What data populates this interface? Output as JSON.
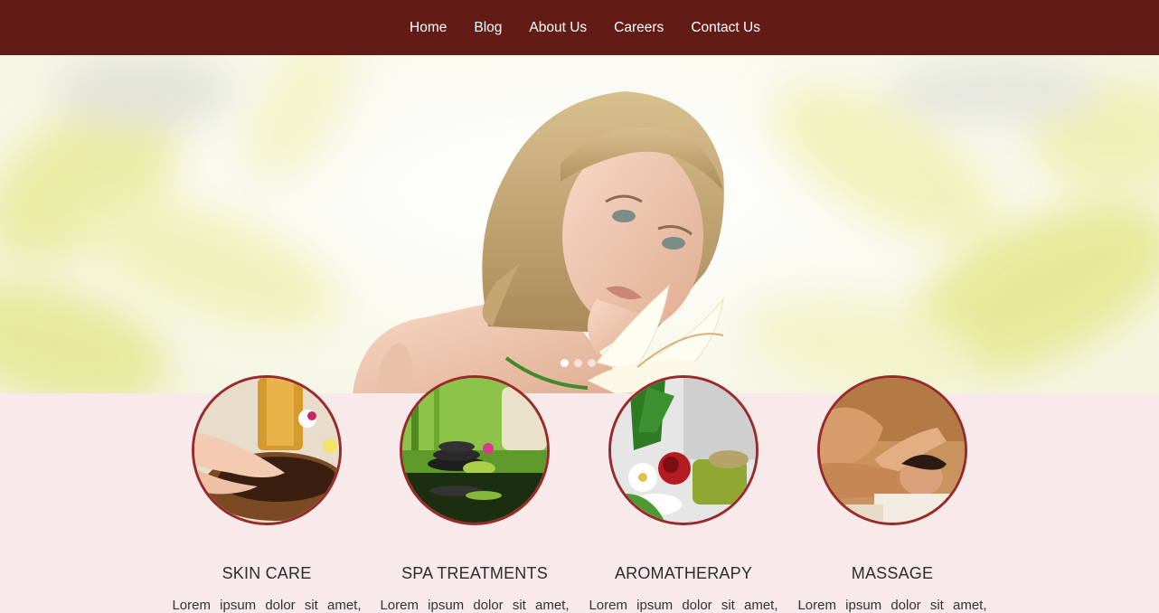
{
  "nav": {
    "items": [
      {
        "label": "Home"
      },
      {
        "label": "Blog"
      },
      {
        "label": "About Us"
      },
      {
        "label": "Careers"
      },
      {
        "label": "Contact Us"
      }
    ]
  },
  "slider": {
    "slide_count": 3,
    "active_index": 0
  },
  "services": [
    {
      "title": "SKIN CARE",
      "text": "Lorem ipsum dolor sit amet,",
      "image": "hands-in-bowl-image"
    },
    {
      "title": "SPA TREATMENTS",
      "text": "Lorem ipsum dolor sit amet,",
      "image": "spa-stones-image"
    },
    {
      "title": "AROMATHERAPY",
      "text": "Lorem ipsum dolor sit amet,",
      "image": "flowers-oils-image"
    },
    {
      "title": "MASSAGE",
      "text": "Lorem ipsum dolor sit amet,",
      "image": "massage-image"
    }
  ],
  "colors": {
    "nav_bg": "#621c15",
    "section_bg": "#f8eaea",
    "circle_border": "#9a2a2a"
  }
}
